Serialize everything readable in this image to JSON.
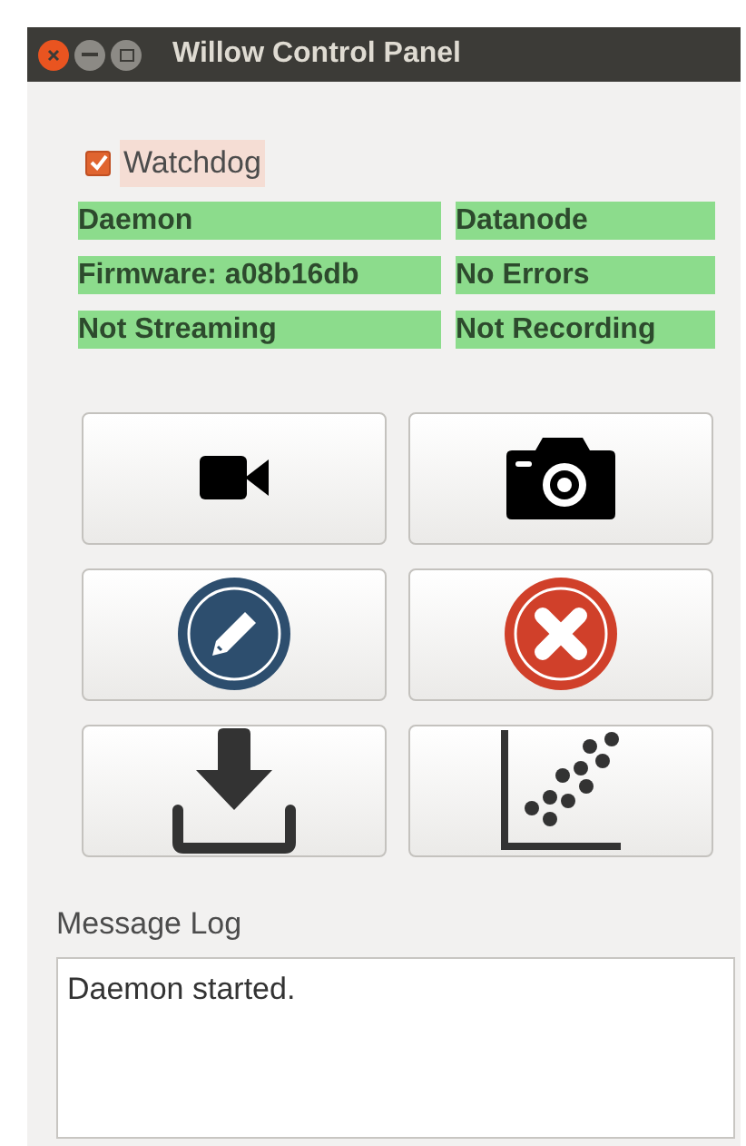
{
  "window": {
    "title": "Willow Control Panel"
  },
  "watchdog": {
    "label": "Watchdog",
    "checked": true
  },
  "status": [
    "Daemon",
    "Datanode",
    "Firmware: a08b16db",
    "No Errors",
    "Not Streaming",
    "Not Recording"
  ],
  "buttons": [
    {
      "kind": "video"
    },
    {
      "kind": "camera"
    },
    {
      "kind": "edit"
    },
    {
      "kind": "cancel"
    },
    {
      "kind": "download"
    },
    {
      "kind": "scatter"
    }
  ],
  "message_log": {
    "label": "Message Log",
    "lines": [
      "Daemon started."
    ]
  }
}
